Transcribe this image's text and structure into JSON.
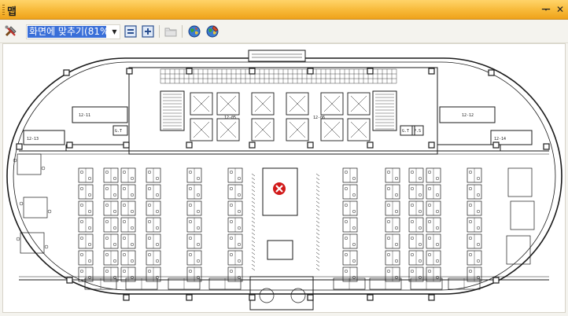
{
  "window": {
    "title": "맵"
  },
  "titlebar_buttons": {
    "pin_glyph": "ᅮ",
    "close_glyph": "✕"
  },
  "toolbar": {
    "zoom_select": {
      "value": "화면에 맞추기(81%)"
    },
    "icons": [
      "tools-icon",
      "fit-page-icon",
      "zoom-in-icon",
      "folder-icon",
      "globe-icon",
      "globe-edit-icon"
    ]
  },
  "floorplan": {
    "room_labels": [
      "12-11",
      "12-13",
      "12-12",
      "12-14",
      "12-05",
      "12-06",
      "G.T",
      "G.T",
      "P.S"
    ],
    "alert_icon": "error-x-icon",
    "colors": {
      "line": "#1a1a1a",
      "alert": "#d11a1a"
    }
  }
}
